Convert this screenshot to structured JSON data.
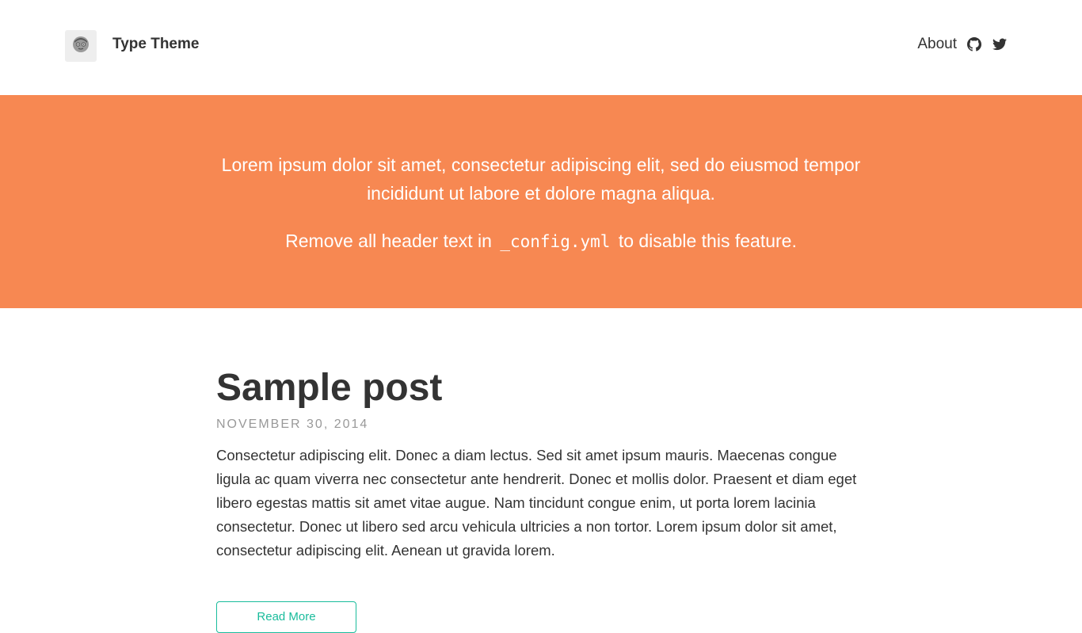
{
  "nav": {
    "site_title": "Type Theme",
    "about_label": "About",
    "avatar_icon": "avatar-face-icon",
    "github_icon": "github-icon",
    "twitter_icon": "twitter-icon"
  },
  "hero": {
    "lead": "Lorem ipsum dolor sit amet, consectetur adipiscing elit, sed do eiusmod tempor incididunt ut labore et dolore magna aliqua.",
    "note_before": "Remove all header text in",
    "note_code": "_config.yml",
    "note_after": "to disable this feature.",
    "background_color": "#f78852"
  },
  "post": {
    "title": "Sample post",
    "date": "NOVEMBER 30, 2014",
    "excerpt": "Consectetur adipiscing elit. Donec a diam lectus. Sed sit amet ipsum mauris. Maecenas congue ligula ac quam viverra nec consectetur ante hendrerit. Donec et mollis dolor. Praesent et diam eget libero egestas mattis sit amet vitae augue. Nam tincidunt congue enim, ut porta lorem lacinia consectetur. Donec ut libero sed arcu vehicula ultricies a non tortor. Lorem ipsum dolor sit amet, consectetur adipiscing elit. Aenean ut gravida lorem.",
    "read_more_label": "Read More",
    "accent_color": "#1abc9c"
  }
}
